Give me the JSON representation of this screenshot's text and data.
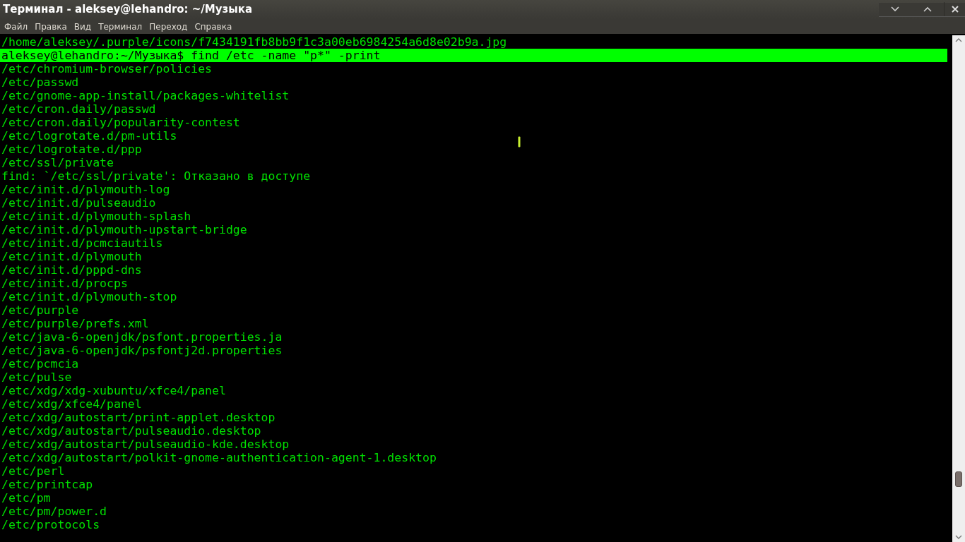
{
  "window": {
    "title": "Терминал - aleksey@lehandro: ~/Музыка"
  },
  "menu": [
    "Файл",
    "Правка",
    "Вид",
    "Терминал",
    "Переход",
    "Справка"
  ],
  "lines": [
    {
      "text": "/home/aleksey/.purple/icons/f7434191fb8bb9f1c3a00eb6984254a6d8e02b9a.jpg",
      "highlighted": false
    },
    {
      "text": "aleksey@lehandro:~/Музыка$ find /etc -name \"p*\" -print",
      "highlighted": true
    },
    {
      "text": "/etc/chromium-browser/policies",
      "highlighted": false
    },
    {
      "text": "/etc/passwd",
      "highlighted": false
    },
    {
      "text": "/etc/gnome-app-install/packages-whitelist",
      "highlighted": false
    },
    {
      "text": "/etc/cron.daily/passwd",
      "highlighted": false
    },
    {
      "text": "/etc/cron.daily/popularity-contest",
      "highlighted": false
    },
    {
      "text": "/etc/logrotate.d/pm-utils",
      "highlighted": false
    },
    {
      "text": "/etc/logrotate.d/ppp",
      "highlighted": false
    },
    {
      "text": "/etc/ssl/private",
      "highlighted": false
    },
    {
      "text": "find: `/etc/ssl/private': Отказано в доступе",
      "highlighted": false
    },
    {
      "text": "/etc/init.d/plymouth-log",
      "highlighted": false
    },
    {
      "text": "/etc/init.d/pulseaudio",
      "highlighted": false
    },
    {
      "text": "/etc/init.d/plymouth-splash",
      "highlighted": false
    },
    {
      "text": "/etc/init.d/plymouth-upstart-bridge",
      "highlighted": false
    },
    {
      "text": "/etc/init.d/pcmciautils",
      "highlighted": false
    },
    {
      "text": "/etc/init.d/plymouth",
      "highlighted": false
    },
    {
      "text": "/etc/init.d/pppd-dns",
      "highlighted": false
    },
    {
      "text": "/etc/init.d/procps",
      "highlighted": false
    },
    {
      "text": "/etc/init.d/plymouth-stop",
      "highlighted": false
    },
    {
      "text": "/etc/purple",
      "highlighted": false
    },
    {
      "text": "/etc/purple/prefs.xml",
      "highlighted": false
    },
    {
      "text": "/etc/java-6-openjdk/psfont.properties.ja",
      "highlighted": false
    },
    {
      "text": "/etc/java-6-openjdk/psfontj2d.properties",
      "highlighted": false
    },
    {
      "text": "/etc/pcmcia",
      "highlighted": false
    },
    {
      "text": "/etc/pulse",
      "highlighted": false
    },
    {
      "text": "/etc/xdg/xdg-xubuntu/xfce4/panel",
      "highlighted": false
    },
    {
      "text": "/etc/xdg/xfce4/panel",
      "highlighted": false
    },
    {
      "text": "/etc/xdg/autostart/print-applet.desktop",
      "highlighted": false
    },
    {
      "text": "/etc/xdg/autostart/pulseaudio.desktop",
      "highlighted": false
    },
    {
      "text": "/etc/xdg/autostart/pulseaudio-kde.desktop",
      "highlighted": false
    },
    {
      "text": "/etc/xdg/autostart/polkit-gnome-authentication-agent-1.desktop",
      "highlighted": false
    },
    {
      "text": "/etc/perl",
      "highlighted": false
    },
    {
      "text": "/etc/printcap",
      "highlighted": false
    },
    {
      "text": "/etc/pm",
      "highlighted": false
    },
    {
      "text": "/etc/pm/power.d",
      "highlighted": false
    },
    {
      "text": "/etc/protocols",
      "highlighted": false
    }
  ]
}
